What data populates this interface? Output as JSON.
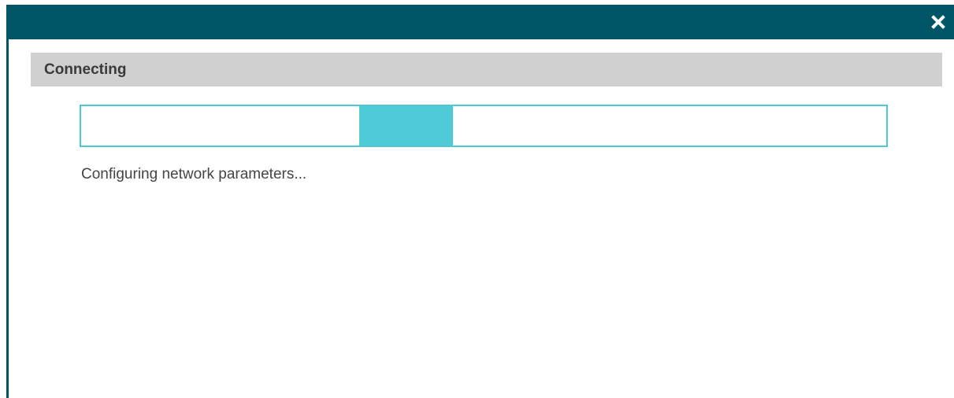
{
  "titlebar": {
    "close_icon": "close-icon",
    "background_color": "#005566"
  },
  "dialog": {
    "header_title": "Connecting",
    "status_text": "Configuring network parameters..."
  },
  "progress": {
    "mode": "indeterminate",
    "segment_start_fraction": 0.345,
    "segment_end_fraction": 0.462,
    "accent_color": "#4ecbd6"
  }
}
